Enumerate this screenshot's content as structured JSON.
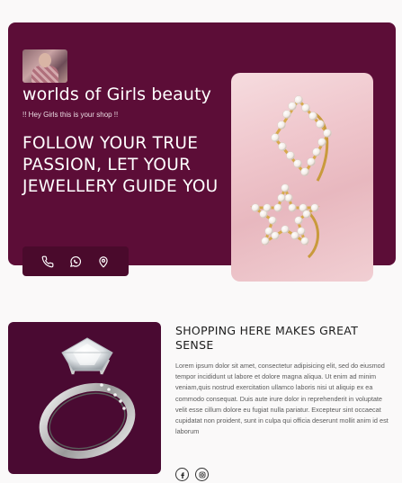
{
  "hero": {
    "brand": "worlds of Girls beauty",
    "tagline": "!! Hey Girls this is your shop !!",
    "headline": "FOLLOW YOUR TRUE PASSION, LET YOUR JEWELLERY GUIDE YOU",
    "contact_icons": [
      "phone-icon",
      "whatsapp-icon",
      "location-icon"
    ],
    "background_color": "#5c0d37"
  },
  "section": {
    "title": "SHOPPING HERE MAKES GREAT SENSE",
    "body": "Lorem ipsum dolor sit amet, consectetur adipisicing elit, sed do eiusmod tempor incididunt ut labore et dolore magna aliqua. Ut enim ad minim veniam,quis nostrud exercitation ullamco laboris nisi ut aliquip ex ea commodo consequat. Duis aute irure dolor in reprehenderit in voluptate velit esse cillum dolore eu fugiat nulla pariatur. Excepteur sint occaecat cupidatat non proident, sunt in culpa qui officia deserunt mollit anim id est laborum",
    "social_icons": [
      "facebook-icon",
      "instagram-icon"
    ]
  }
}
